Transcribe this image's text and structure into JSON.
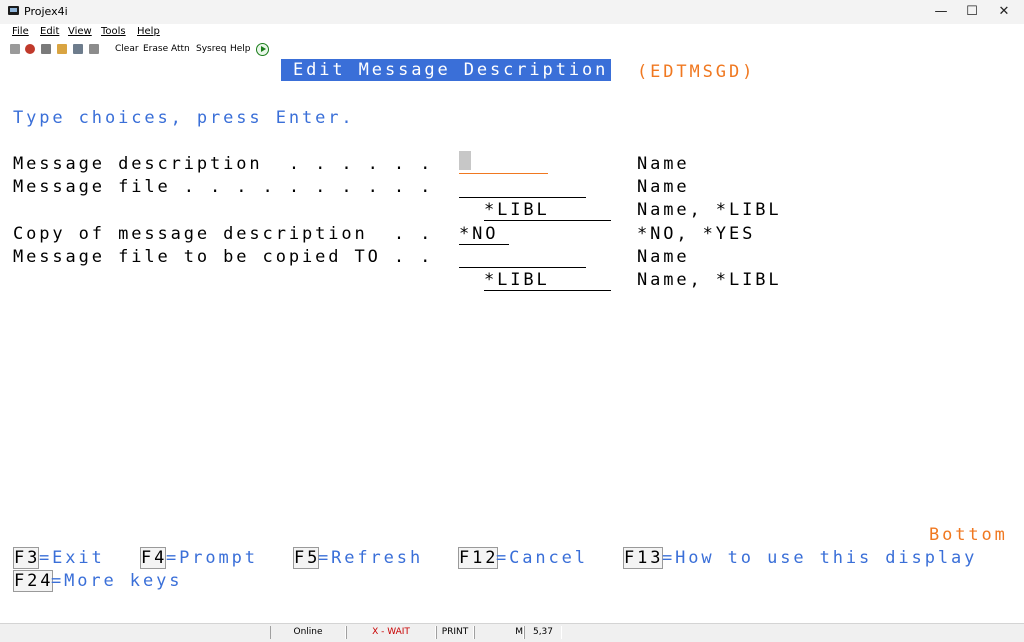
{
  "window": {
    "title": "Projex4i",
    "minimize": "—",
    "maximize": "☐",
    "close": "✕"
  },
  "menu": [
    "File",
    "Edit",
    "View",
    "Tools",
    "Help"
  ],
  "toolbar": {
    "clear": "Clear",
    "erase": "Erase",
    "attn": "Attn",
    "sysreq": "Sysreq",
    "help": "Help"
  },
  "screen": {
    "title": "Edit Message Description",
    "command": "(EDTMSGD)",
    "instructions": "Type choices, press Enter.",
    "rows": [
      {
        "label": "Message description  . . . . . .",
        "hint": "Name"
      },
      {
        "label": "Message file . . . . . . . . . .",
        "hint": "Name"
      },
      {
        "value": "*LIBL",
        "hint": "Name, *LIBL"
      },
      {
        "label": "Copy of message description  . .",
        "value": "*NO",
        "hint": "*NO, *YES"
      },
      {
        "label": "Message file to be copied TO . .",
        "hint": "Name"
      },
      {
        "value": "*LIBL",
        "hint": "Name, *LIBL"
      }
    ],
    "bottom": "Bottom",
    "function_keys": [
      {
        "key": "F3",
        "text": "=Exit"
      },
      {
        "key": "F4",
        "text": "=Prompt"
      },
      {
        "key": "F5",
        "text": "=Refresh"
      },
      {
        "key": "F12",
        "text": "=Cancel"
      },
      {
        "key": "F13",
        "text": "=How to use this display"
      },
      {
        "key": "F24",
        "text": "=More keys"
      }
    ]
  },
  "status": {
    "online": "Online",
    "wait": "X - WAIT",
    "print": "PRINT",
    "mode": "M",
    "position": "5,37"
  }
}
